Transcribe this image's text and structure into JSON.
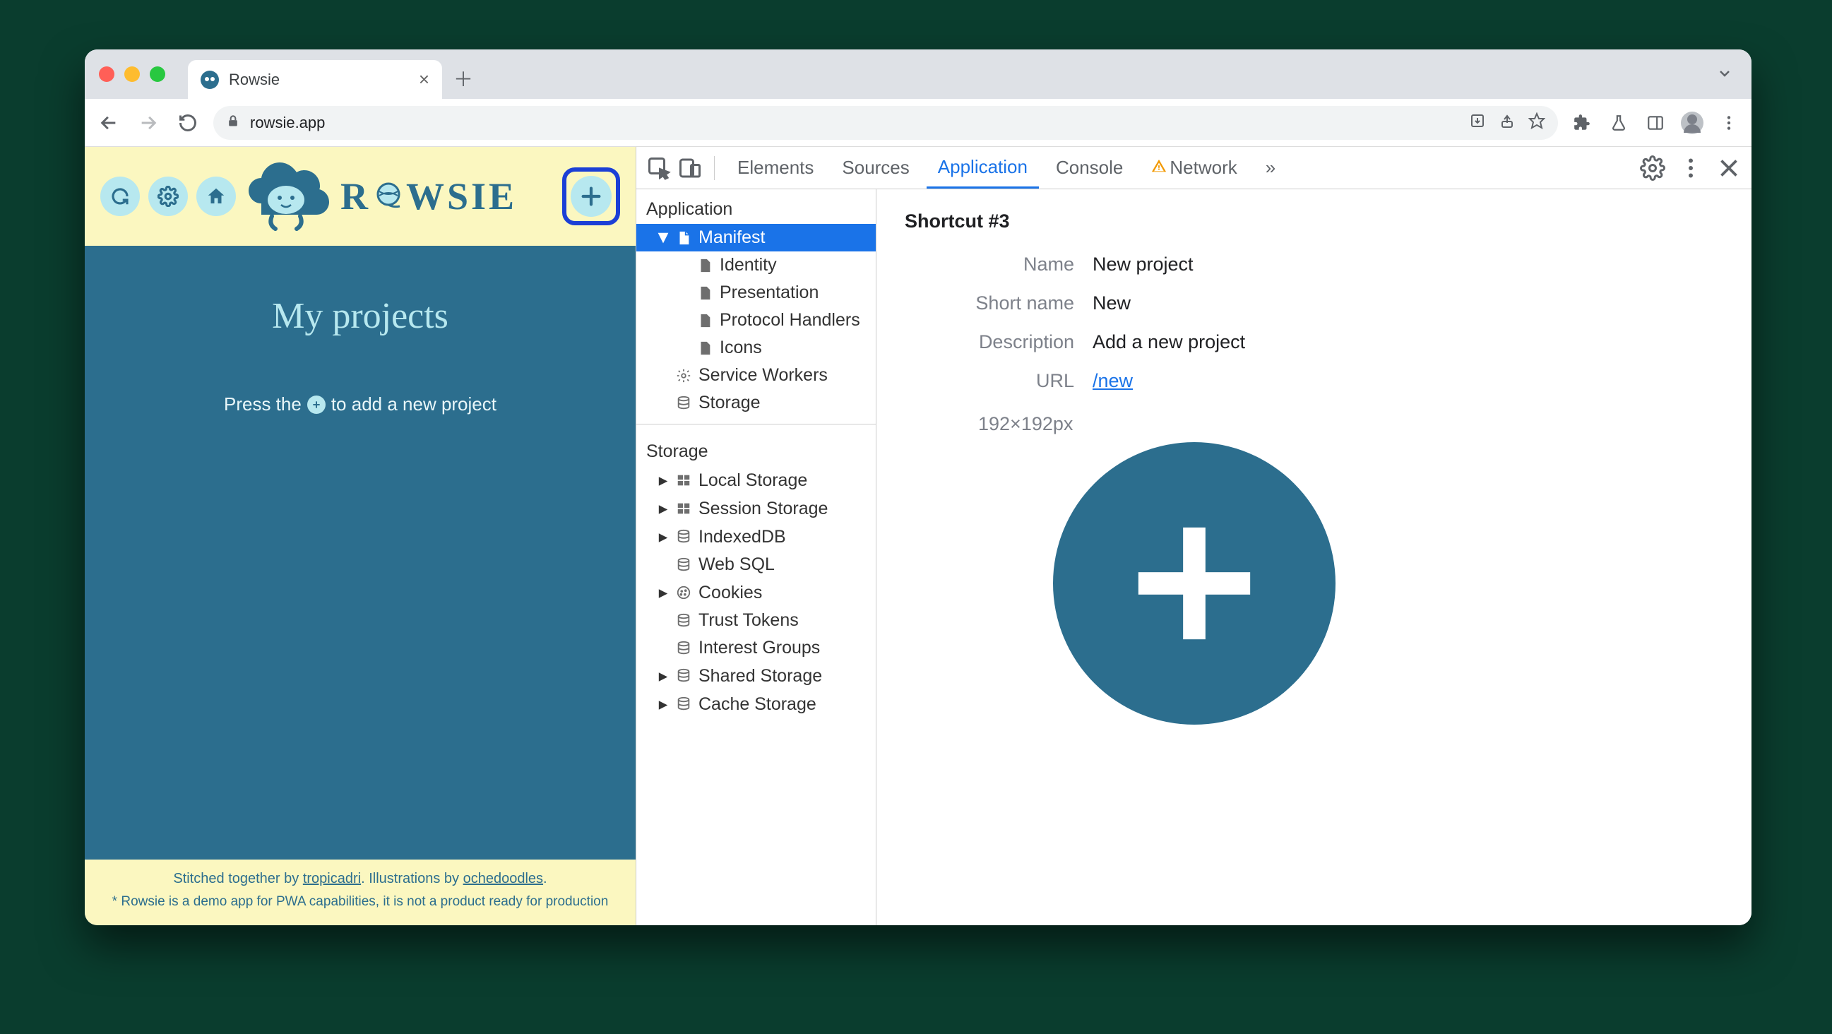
{
  "browser": {
    "tab_title": "Rowsie",
    "address": "rowsie.app"
  },
  "app": {
    "logo_text_pre": "R",
    "logo_text_post": "WSIE",
    "title": "My projects",
    "hint_pre": "Press the",
    "hint_post": "to add a new project",
    "footer_line1_pre": "Stitched together by ",
    "footer_link1": "tropicadri",
    "footer_line1_mid": ". Illustrations by ",
    "footer_link2": "ochedoodles",
    "footer_line1_post": ".",
    "footer_line2": "* Rowsie is a demo app for PWA capabilities, it is not a product ready for production"
  },
  "devtools": {
    "tabs": {
      "elements": "Elements",
      "sources": "Sources",
      "application": "Application",
      "console": "Console",
      "network": "Network",
      "more": "»"
    },
    "tree": {
      "section1": "Application",
      "manifest": "Manifest",
      "identity": "Identity",
      "presentation": "Presentation",
      "protocol": "Protocol Handlers",
      "icons": "Icons",
      "service_workers": "Service Workers",
      "storage_item": "Storage",
      "section2": "Storage",
      "local_storage": "Local Storage",
      "session_storage": "Session Storage",
      "indexeddb": "IndexedDB",
      "web_sql": "Web SQL",
      "cookies": "Cookies",
      "trust_tokens": "Trust Tokens",
      "interest_groups": "Interest Groups",
      "shared_storage": "Shared Storage",
      "cache_storage": "Cache Storage"
    },
    "detail": {
      "heading": "Shortcut #3",
      "labels": {
        "name": "Name",
        "short_name": "Short name",
        "description": "Description",
        "url": "URL"
      },
      "values": {
        "name": "New project",
        "short_name": "New",
        "description": "Add a new project",
        "url": "/new"
      },
      "image_size": "192×192px"
    }
  }
}
